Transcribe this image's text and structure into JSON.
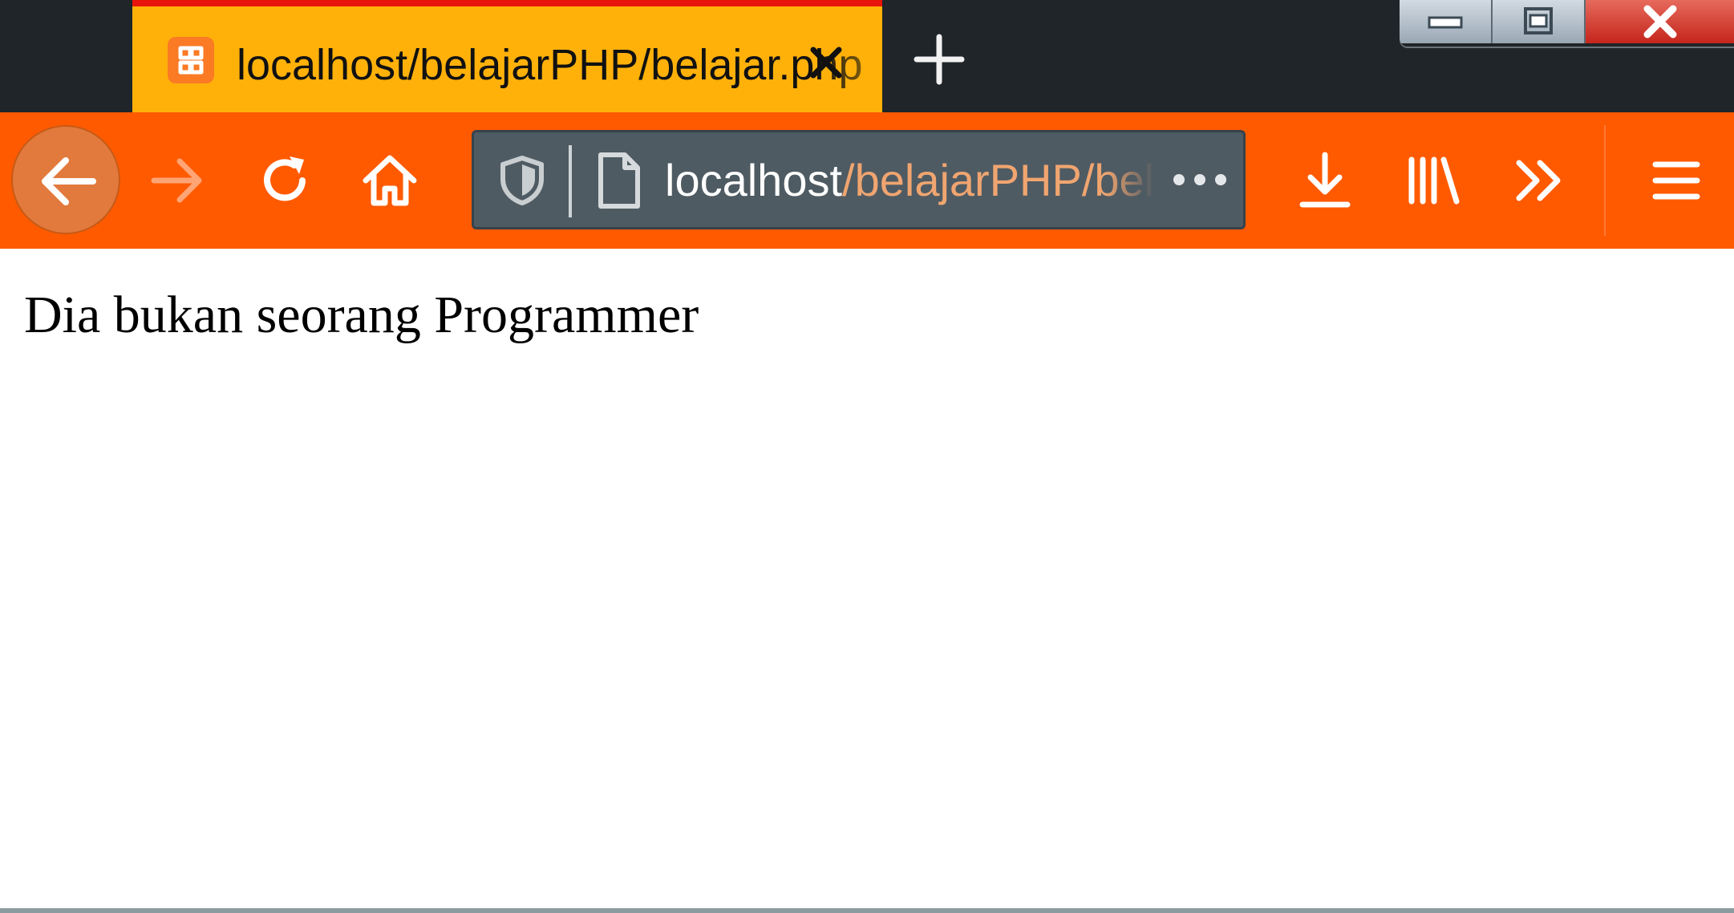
{
  "tab": {
    "title": "localhost/belajarPHP/belajar.php",
    "favicon": "xampp-icon",
    "accent_color": "#ffb10a",
    "highlight_color": "#e8140c"
  },
  "tabstrip": {
    "new_tab_icon": "plus-icon"
  },
  "window_controls": [
    "minimize-icon",
    "maximize-icon",
    "close-icon"
  ],
  "navbar": {
    "color": "#ff5a00",
    "buttons": [
      "back-arrow-icon",
      "forward-arrow-icon",
      "reload-icon",
      "home-icon"
    ],
    "right_buttons": [
      "download-icon",
      "library-icon",
      "overflow-chevron-icon",
      "hamburger-menu-icon"
    ]
  },
  "urlbar": {
    "host": "localhost",
    "path": "/belajarPHP/belajar.php",
    "icons": [
      "shield-icon",
      "page-icon",
      "more-dots-icon"
    ]
  },
  "page": {
    "text": "Dia bukan seorang Programmer"
  }
}
